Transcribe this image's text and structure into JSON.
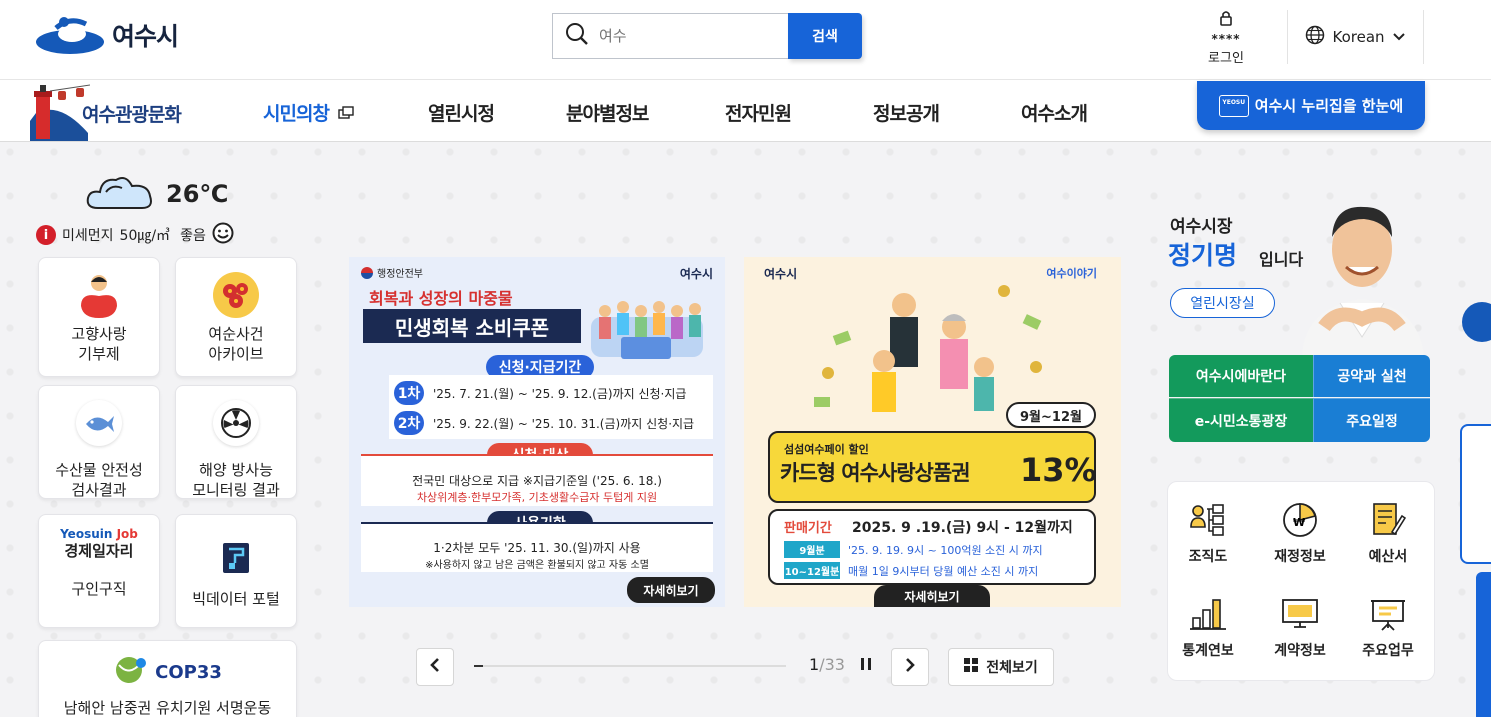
{
  "header": {
    "logo_text": "여수시",
    "search": {
      "placeholder": "여수",
      "button_label": "검색"
    },
    "login": {
      "stars": "****",
      "label": "로그인"
    },
    "language": "Korean"
  },
  "gnb": {
    "tour_label": "여수관광문화",
    "items": [
      "시민의창",
      "열린시정",
      "분야별정보",
      "전자민원",
      "정보공개",
      "여수소개"
    ],
    "banner_label": "여수시 누리집을 한눈에",
    "banner_tag": "YEOSU"
  },
  "weather": {
    "temperature": "26℃",
    "dust_label": "미세먼지",
    "dust_value": "50㎍/㎥",
    "dust_status": "좋음"
  },
  "quick_links": [
    {
      "label": "고향사랑\n기부제"
    },
    {
      "label": "여순사건\n아카이브"
    },
    {
      "label": "수산물 안전성\n검사결과"
    },
    {
      "label": "해양 방사능\n모니터링 결과"
    },
    {
      "job_brand_a": "Yeosuin",
      "job_brand_b": "Job",
      "job_title": "경제일자리",
      "label": "구인구직"
    },
    {
      "label": "빅데이터 포털"
    },
    {
      "brand": "COP33",
      "label": "남해안 남중권 유치기원 서명운동"
    }
  ],
  "slide1": {
    "ministry": "행정안전부",
    "city": "여수시",
    "headline_a": "회복과 성장의 마중물",
    "headline_b": "민생회복 소비쿠폰",
    "period_title": "신청·지급기간",
    "round1_tag": "1차",
    "round1_text": "'25. 7. 21.(월) ~ '25. 9. 12.(금)까지 신청·지급",
    "round2_tag": "2차",
    "round2_text": "'25. 9. 22.(월) ~ '25. 10. 31.(금)까지 신청·지급",
    "target_title": "신청·대상",
    "target_text": "전국민 대상으로 지급 ※지급기준일 ('25. 6. 18.)",
    "target_note": "차상위계층·한부모가족, 기초생활수급자 두텁게 지원",
    "use_title": "사용기한",
    "use_text": "1·2차분 모두 '25. 11. 30.(일)까지 사용",
    "use_note": "※사용하지 않고 남은 금액은 환불되지 않고 자동 소멸",
    "more": "자세히보기"
  },
  "slide2": {
    "city": "여수시",
    "brand": "여수이야기",
    "months": "9월~12월",
    "sub": "섬섬여수페이 할인",
    "title": "카드형 여수사랑상품권",
    "rate": "13%",
    "sale_label": "판매기간",
    "sale_text": "2025. 9 .19.(금) 9시 - 12월까지",
    "row1_tag": "9월분",
    "row1_text": "'25. 9. 19. 9시 ~ 100억원 소진 시 까지",
    "row2_tag": "10~12월분",
    "row2_text": "매월 1일 9시부터 당월 예산 소진 시 까지",
    "more": "자세히보기"
  },
  "slider": {
    "current": "1",
    "total": "/33",
    "progress": 0.0303,
    "view_all": "전체보기"
  },
  "mayor": {
    "title": "여수시장",
    "name": "정기명",
    "suffix": "입니다",
    "room_button": "열린시장실",
    "links": [
      "여수시에바란다",
      "공약과 실천",
      "e-시민소통광장",
      "주요일정"
    ]
  },
  "info_links": [
    "조직도",
    "재정정보",
    "예산서",
    "통계연보",
    "계약정보",
    "주요업무"
  ],
  "colors": {
    "primary": "#1764d8",
    "green": "#139a5c",
    "dark_navy": "#1b2a52"
  }
}
